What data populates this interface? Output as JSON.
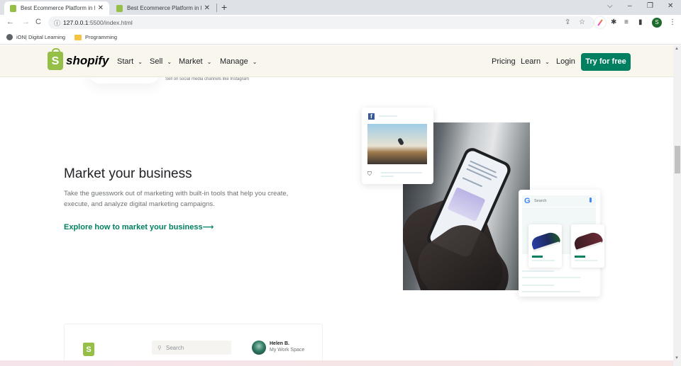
{
  "browser": {
    "tabs": [
      {
        "title": "Best Ecommerce Platform in Indi",
        "active": true
      },
      {
        "title": "Best Ecommerce Platform in Indi",
        "active": false
      }
    ],
    "new_tab_symbol": "+",
    "close_symbol": "✕",
    "window_controls": {
      "tabsearch": "⌵",
      "minimize": "–",
      "restore": "❐",
      "close": "✕"
    },
    "nav": {
      "back": "←",
      "forward": "→",
      "reload": "C"
    },
    "url_host": "127.0.0.1",
    "url_rest": ":5500/index.html",
    "info_icon": "ⓘ",
    "omnibox_icons": {
      "share": "⇪",
      "star": "☆"
    },
    "toolbar_icons": {
      "extensions": "✱",
      "media": "≡",
      "sidepanel": "▮",
      "menu": "⋮"
    },
    "profile_initial": "S",
    "bookmarks": [
      {
        "label": "iON| Digital Learning",
        "icon": "globe-icon"
      },
      {
        "label": "Programming",
        "icon": "folder-icon"
      }
    ]
  },
  "header": {
    "logo_letter": "S",
    "logo_text": "shopify",
    "nav_left": [
      {
        "label": "Start",
        "chevron": "⌄"
      },
      {
        "label": "Sell",
        "chevron": "⌄"
      },
      {
        "label": "Market",
        "chevron": "⌄"
      },
      {
        "label": "Manage",
        "chevron": "⌄"
      }
    ],
    "nav_right": {
      "pricing": "Pricing",
      "learn": "Learn",
      "learn_chevron": "⌄",
      "login": "Login",
      "cta": "Try for free"
    },
    "brand_color": "#008060",
    "logo_color": "#95bf47"
  },
  "previous_section": {
    "caption": "Sell on social media channels like Instagram"
  },
  "market_section": {
    "title": "Market your business",
    "description": "Take the guesswork out of marketing with built-in tools that help you create, execute, and analyze digital marketing campaigns.",
    "link": "Explore how to market your business",
    "link_arrow": "⟶",
    "fb_letter": "f",
    "bag_icon": "⛉",
    "google_letter": "G",
    "google_search_placeholder": "Search"
  },
  "next_section_preview": {
    "logo_letter": "S",
    "search_icon": "⚲",
    "search_placeholder": "Search",
    "user_name": "Helen B.",
    "workspace": "My Work Space"
  },
  "scrollbar": {
    "up": "▲",
    "down": "▼"
  }
}
